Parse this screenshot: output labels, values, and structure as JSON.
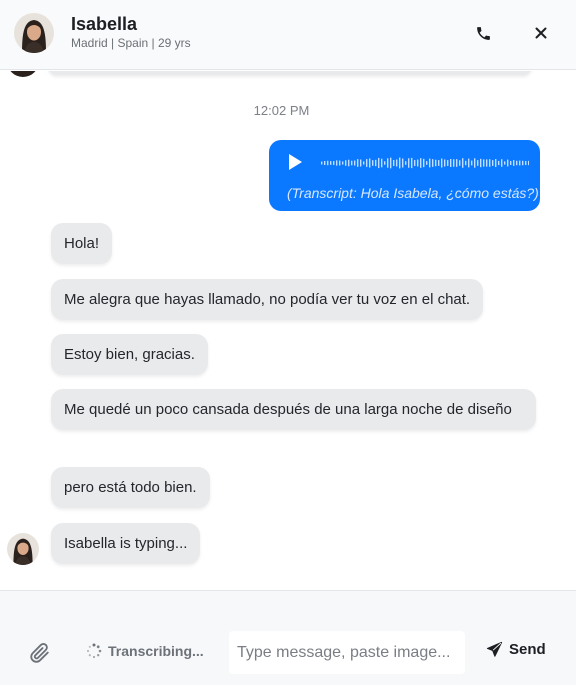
{
  "header": {
    "name": "Isabella",
    "meta": "Madrid | Spain | 29 yrs",
    "icons": {
      "call": "phone-icon",
      "close": "close-icon"
    }
  },
  "chat": {
    "timestamp": "12:02 PM",
    "voice_message": {
      "transcript": "(Transcript: Hola Isabela, ¿cómo estás?)",
      "color": "#0a78ff"
    },
    "messages": [
      "Hola!",
      "Me alegra que hayas llamado, no podía ver tu voz en el chat.",
      "Estoy bien, gracias.",
      "Me quedé un poco cansada después de una larga noche de diseño",
      "pero está todo bien.",
      "Isabella is typing..."
    ]
  },
  "input_bar": {
    "status": "Transcribing...",
    "placeholder": "Type message, paste image...",
    "value": "",
    "send_label": "Send",
    "icons": {
      "attach": "paperclip-icon",
      "status": "spinner-icon",
      "send": "send-icon"
    }
  }
}
